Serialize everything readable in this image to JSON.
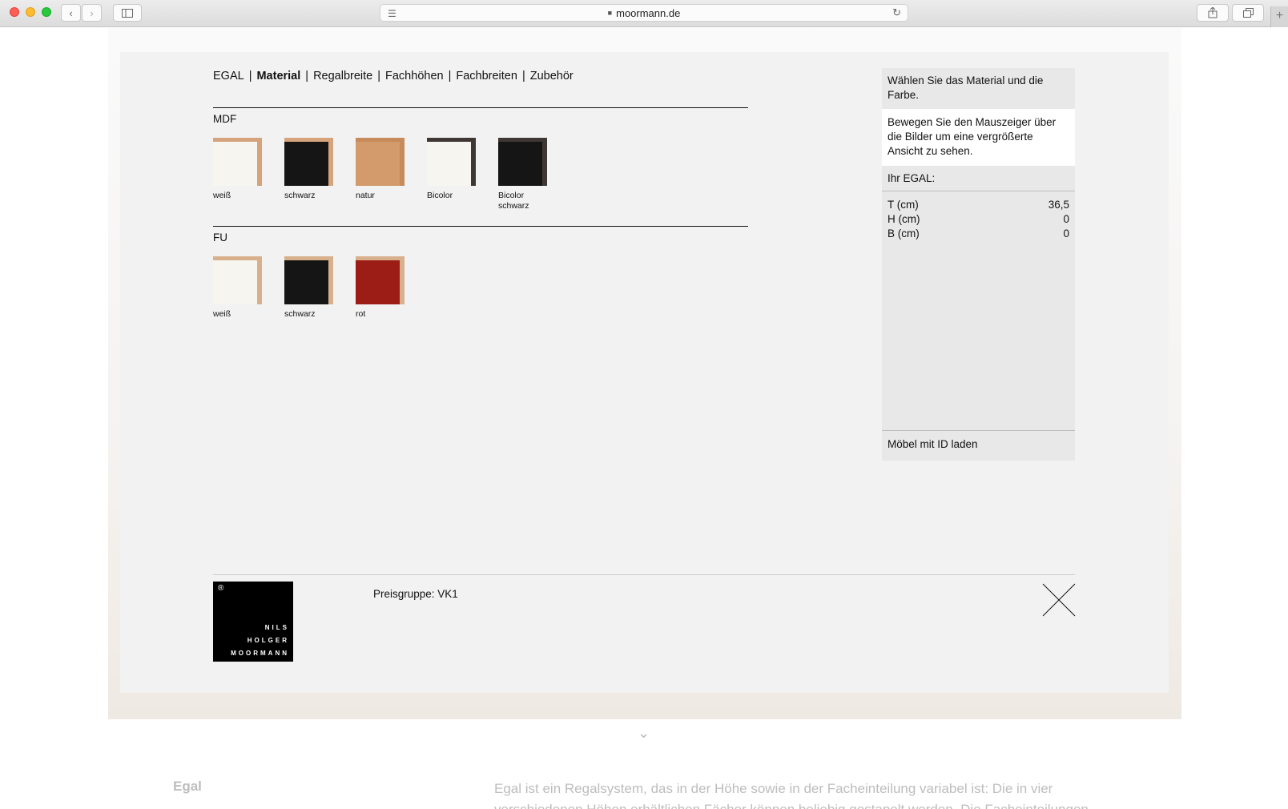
{
  "browser": {
    "url": "moormann.de",
    "back_icon": "chevron-left-icon",
    "forward_icon": "chevron-right-icon",
    "sidebar_icon": "sidebar-icon",
    "share_icon": "share-icon",
    "tabs_icon": "tabs-icon",
    "newtab_label": "+"
  },
  "tabs": [
    {
      "label": "EGAL",
      "active": false
    },
    {
      "label": "Material",
      "active": true
    },
    {
      "label": "Regalbreite",
      "active": false
    },
    {
      "label": "Fachhöhen",
      "active": false
    },
    {
      "label": "Fachbreiten",
      "active": false
    },
    {
      "label": "Zubehör",
      "active": false
    }
  ],
  "tab_separator": "|",
  "sections": {
    "mdf": {
      "title": "MDF",
      "items": [
        {
          "label": "weiß",
          "face": "#f7f5ef",
          "edge": "#d5a47d"
        },
        {
          "label": "schwarz",
          "face": "#151515",
          "edge": "#d5a47d"
        },
        {
          "label": "natur",
          "face": "#d39a6c",
          "edge": "#c68a5b"
        },
        {
          "label": "Bicolor",
          "face": "#f7f5ef",
          "edge": "#3f3733"
        },
        {
          "label": "Bicolor schwarz",
          "face": "#151515",
          "edge": "#3f3733"
        }
      ]
    },
    "fu": {
      "title": "FU",
      "items": [
        {
          "label": "weiß",
          "face": "#f7f5ef",
          "edge": "#d9b08c"
        },
        {
          "label": "schwarz",
          "face": "#151515",
          "edge": "#d9b08c"
        },
        {
          "label": "rot",
          "face": "#9c1c16",
          "edge": "#d9b08c"
        }
      ]
    }
  },
  "panel": {
    "heading": "Wählen Sie das Material und die Farbe.",
    "hint": "Bewegen Sie den Mauszeiger über die Bilder um eine vergrößerte Ansicht zu sehen.",
    "your_label": "Ihr EGAL:",
    "dimensions": [
      {
        "label": "T (cm)",
        "value": "36,5"
      },
      {
        "label": "H (cm)",
        "value": "0"
      },
      {
        "label": "B (cm)",
        "value": "0"
      }
    ],
    "load_label": "Möbel mit ID laden"
  },
  "footer": {
    "logo": {
      "reg": "®",
      "line1": "NILS",
      "line2": "HOLGER",
      "line3": "MOORMANN"
    },
    "price": "Preisgruppe: VK1",
    "close_icon": "close-icon"
  },
  "background_page": {
    "title": "Egal",
    "text": "Egal ist ein Regalsystem, das in der Höhe sowie in der Facheinteilung variabel ist: Die in vier verschiedenen Höhen erhältlichen Fächer können beliebig gestapelt werden. Die Facheinteilungen"
  },
  "colors": {
    "modal_bg": "#f2f2f2",
    "panel_bg": "#e8e8e8",
    "text": "#111111"
  }
}
